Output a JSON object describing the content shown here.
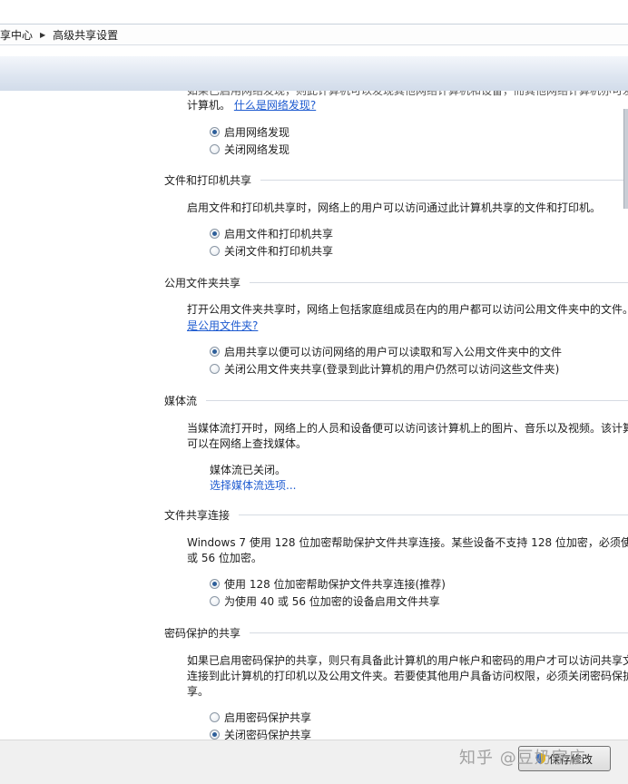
{
  "breadcrumb": {
    "items": [
      "享中心",
      "高级共享设置"
    ]
  },
  "network_discovery": {
    "cut_text_1": "如果已启用网络发现，则此计算机可以发现其他网络计算机和设备，而其他网络计算机亦可发",
    "desc_line_2": "计算机。",
    "link": "什么是网络发现?",
    "options": [
      "启用网络发现",
      "关闭网络发现"
    ],
    "selected": 0
  },
  "file_printer": {
    "title": "文件和打印机共享",
    "desc": "启用文件和打印机共享时，网络上的用户可以访问通过此计算机共享的文件和打印机。",
    "options": [
      "启用文件和打印机共享",
      "关闭文件和打印机共享"
    ],
    "selected": 0
  },
  "public_folder": {
    "title": "公用文件夹共享",
    "desc": "打开公用文件夹共享时，网络上包括家庭组成员在内的用户都可以访问公用文件夹中的文件。",
    "link": "是公用文件夹?",
    "options": [
      "启用共享以便可以访问网络的用户可以读取和写入公用文件夹中的文件",
      "关闭公用文件夹共享(登录到此计算机的用户仍然可以访问这些文件夹)"
    ],
    "selected": 0
  },
  "media_streaming": {
    "title": "媒体流",
    "desc_line_1": "当媒体流打开时，网络上的人员和设备便可以访问该计算机上的图片、音乐以及视频。该计算",
    "desc_line_2": "可以在网络上查找媒体。",
    "status": "媒体流已关闭。",
    "link": "选择媒体流选项..."
  },
  "file_sharing_conn": {
    "title": "文件共享连接",
    "desc_line_1": "Windows 7 使用 128 位加密帮助保护文件共享连接。某些设备不支持 128 位加密，必须使",
    "desc_line_2": "或 56 位加密。",
    "options": [
      "使用 128 位加密帮助保护文件共享连接(推荐)",
      "为使用 40 或 56 位加密的设备启用文件共享"
    ],
    "selected": 0
  },
  "password_protected": {
    "title": "密码保护的共享",
    "desc_line_1": "如果已启用密码保护的共享，则只有具备此计算机的用户帐户和密码的用户才可以访问共享文",
    "desc_line_2": "连接到此计算机的打印机以及公用文件夹。若要使其他用户具备访问权限，必须关闭密码保护",
    "desc_line_3": "享。",
    "options": [
      "启用密码保护共享",
      "关闭密码保护共享"
    ],
    "selected": 1
  },
  "footer": {
    "save_label": "保存修改"
  },
  "watermark": "知乎 @豆奶家庄",
  "colors": {
    "link": "#1e5bd0",
    "radio_dot": "#2e5f9a"
  }
}
